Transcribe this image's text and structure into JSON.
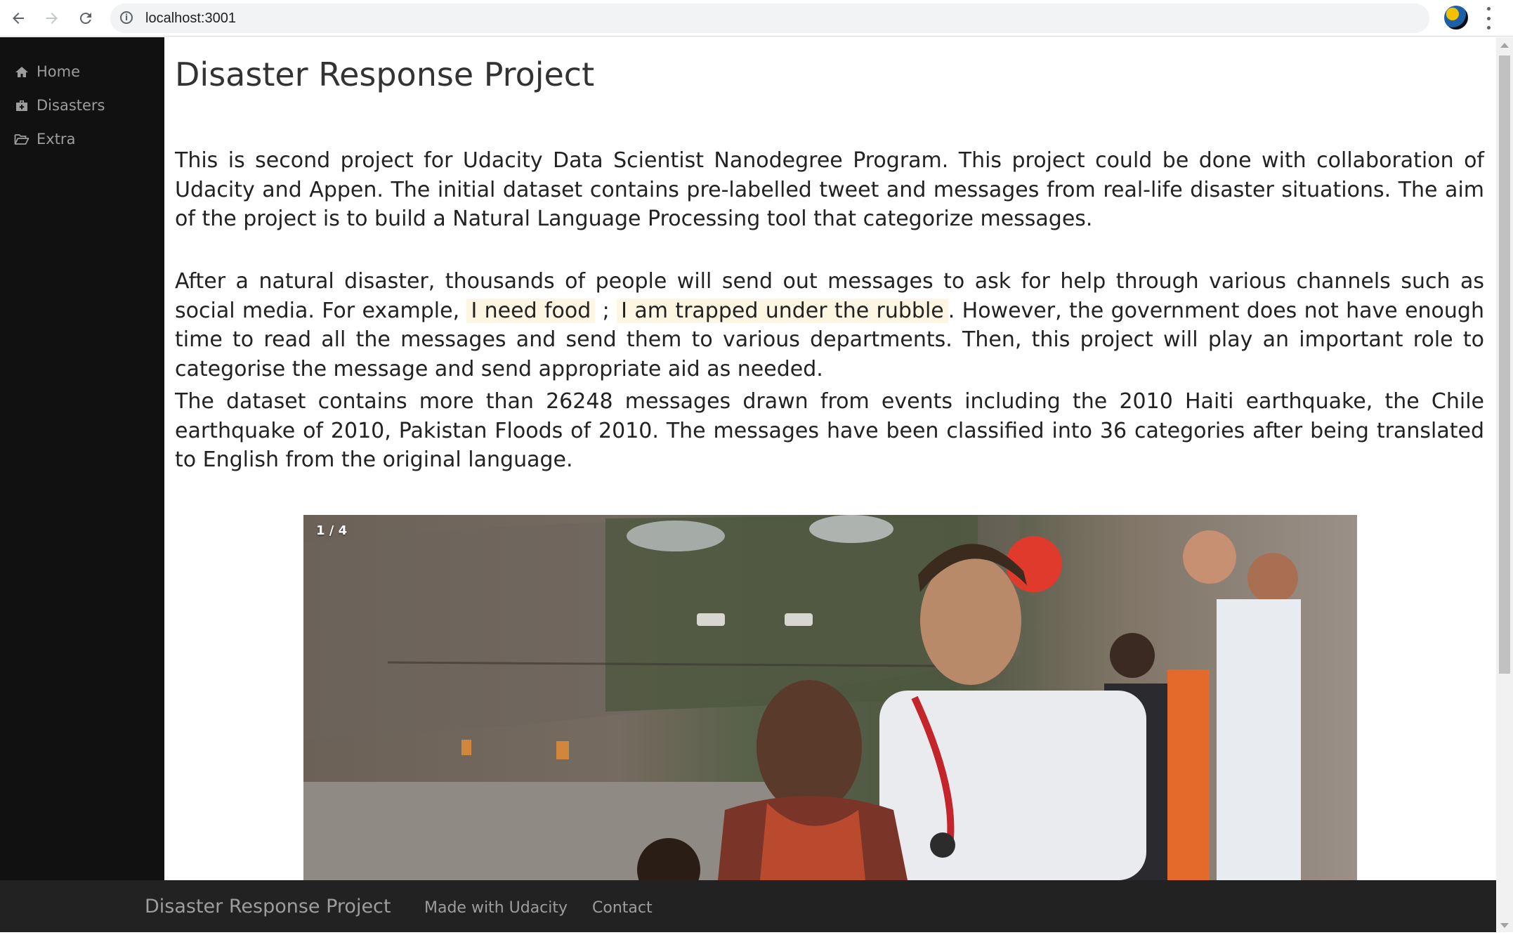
{
  "browser": {
    "url": "localhost:3001",
    "back_icon": "arrow-left-icon",
    "forward_icon": "arrow-right-icon",
    "reload_icon": "reload-icon",
    "star_icon": "star-icon",
    "menu_icon": "more-vert-icon"
  },
  "sidebar": {
    "background": "#111111",
    "items": [
      {
        "label": "Home",
        "icon": "home-icon"
      },
      {
        "label": "Disasters",
        "icon": "briefcase-medical-icon"
      },
      {
        "label": "Extra",
        "icon": "folder-open-icon"
      }
    ]
  },
  "main": {
    "title": "Disaster Response Project",
    "paragraph1": "This is second project for Udacity Data Scientist Nanodegree Program. This project could be done with collaboration of Udacity and Appen. The initial dataset contains pre-labelled tweet and messages from real-life disaster situations. The aim of the project is to build a Natural Language Processing tool that categorize messages.",
    "paragraph2": {
      "before": "After a natural disaster, thousands of people will send out messages to ask for help through various channels such as social media. For example, ",
      "quote1": "I need food",
      "separator": " ; ",
      "quote2": "I am trapped under the rubble",
      "after": ". However, the government does not have enough time to read all the messages and send them to various departments. Then, this project will play an important role to categorise the message and send appropriate aid as needed."
    },
    "paragraph3": "The dataset contains more than 26248 messages drawn from events including the 2010 Haiti earthquake, the Chile earthquake of 2010, Pakistan Floods of 2010. The messages have been classified into 36 categories after being translated to English from the original language.",
    "carousel": {
      "counter": "1 / 4"
    }
  },
  "footer": {
    "brand": "Disaster Response Project",
    "links": [
      "Made with Udacity",
      "Contact"
    ],
    "background": "#222222"
  }
}
